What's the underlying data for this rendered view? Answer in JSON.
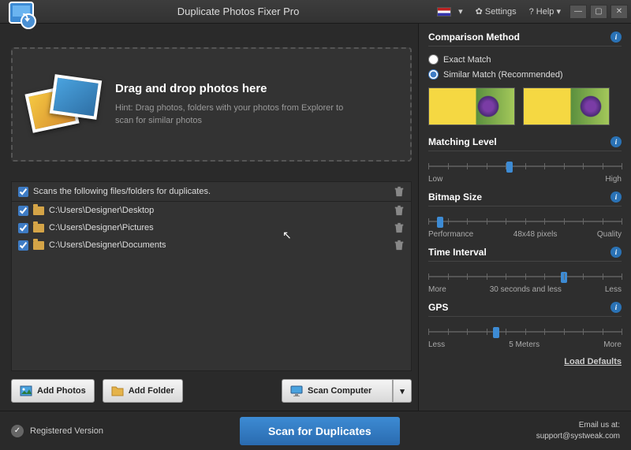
{
  "titlebar": {
    "app_name": "Duplicate Photos Fixer Pro",
    "settings": "Settings",
    "help": "? Help"
  },
  "dropzone": {
    "heading": "Drag and drop photos here",
    "hint": "Hint: Drag photos, folders with your photos from Explorer to scan for similar photos"
  },
  "filelist": {
    "header": "Scans the following files/folders for duplicates.",
    "items": [
      {
        "path": "C:\\Users\\Designer\\Desktop"
      },
      {
        "path": "C:\\Users\\Designer\\Pictures"
      },
      {
        "path": "C:\\Users\\Designer\\Documents"
      }
    ]
  },
  "buttons": {
    "add_photos": "Add Photos",
    "add_folder": "Add Folder",
    "scan_computer": "Scan Computer"
  },
  "sidebar": {
    "comparison_heading": "Comparison Method",
    "exact_match": "Exact Match",
    "similar_match": "Similar Match (Recommended)",
    "matching_level": {
      "title": "Matching Level",
      "left": "Low",
      "right": "High",
      "value_pct": 42
    },
    "bitmap": {
      "title": "Bitmap Size",
      "left": "Performance",
      "mid": "48x48 pixels",
      "right": "Quality",
      "value_pct": 6
    },
    "time": {
      "title": "Time Interval",
      "left": "More",
      "mid": "30 seconds and less",
      "right": "Less",
      "value_pct": 70
    },
    "gps": {
      "title": "GPS",
      "left": "Less",
      "mid": "5 Meters",
      "right": "More",
      "value_pct": 35
    },
    "load_defaults": "Load Defaults"
  },
  "footer": {
    "registered": "Registered Version",
    "scan_btn": "Scan for Duplicates",
    "email_label": "Email us at:",
    "email": "support@systweak.com"
  }
}
